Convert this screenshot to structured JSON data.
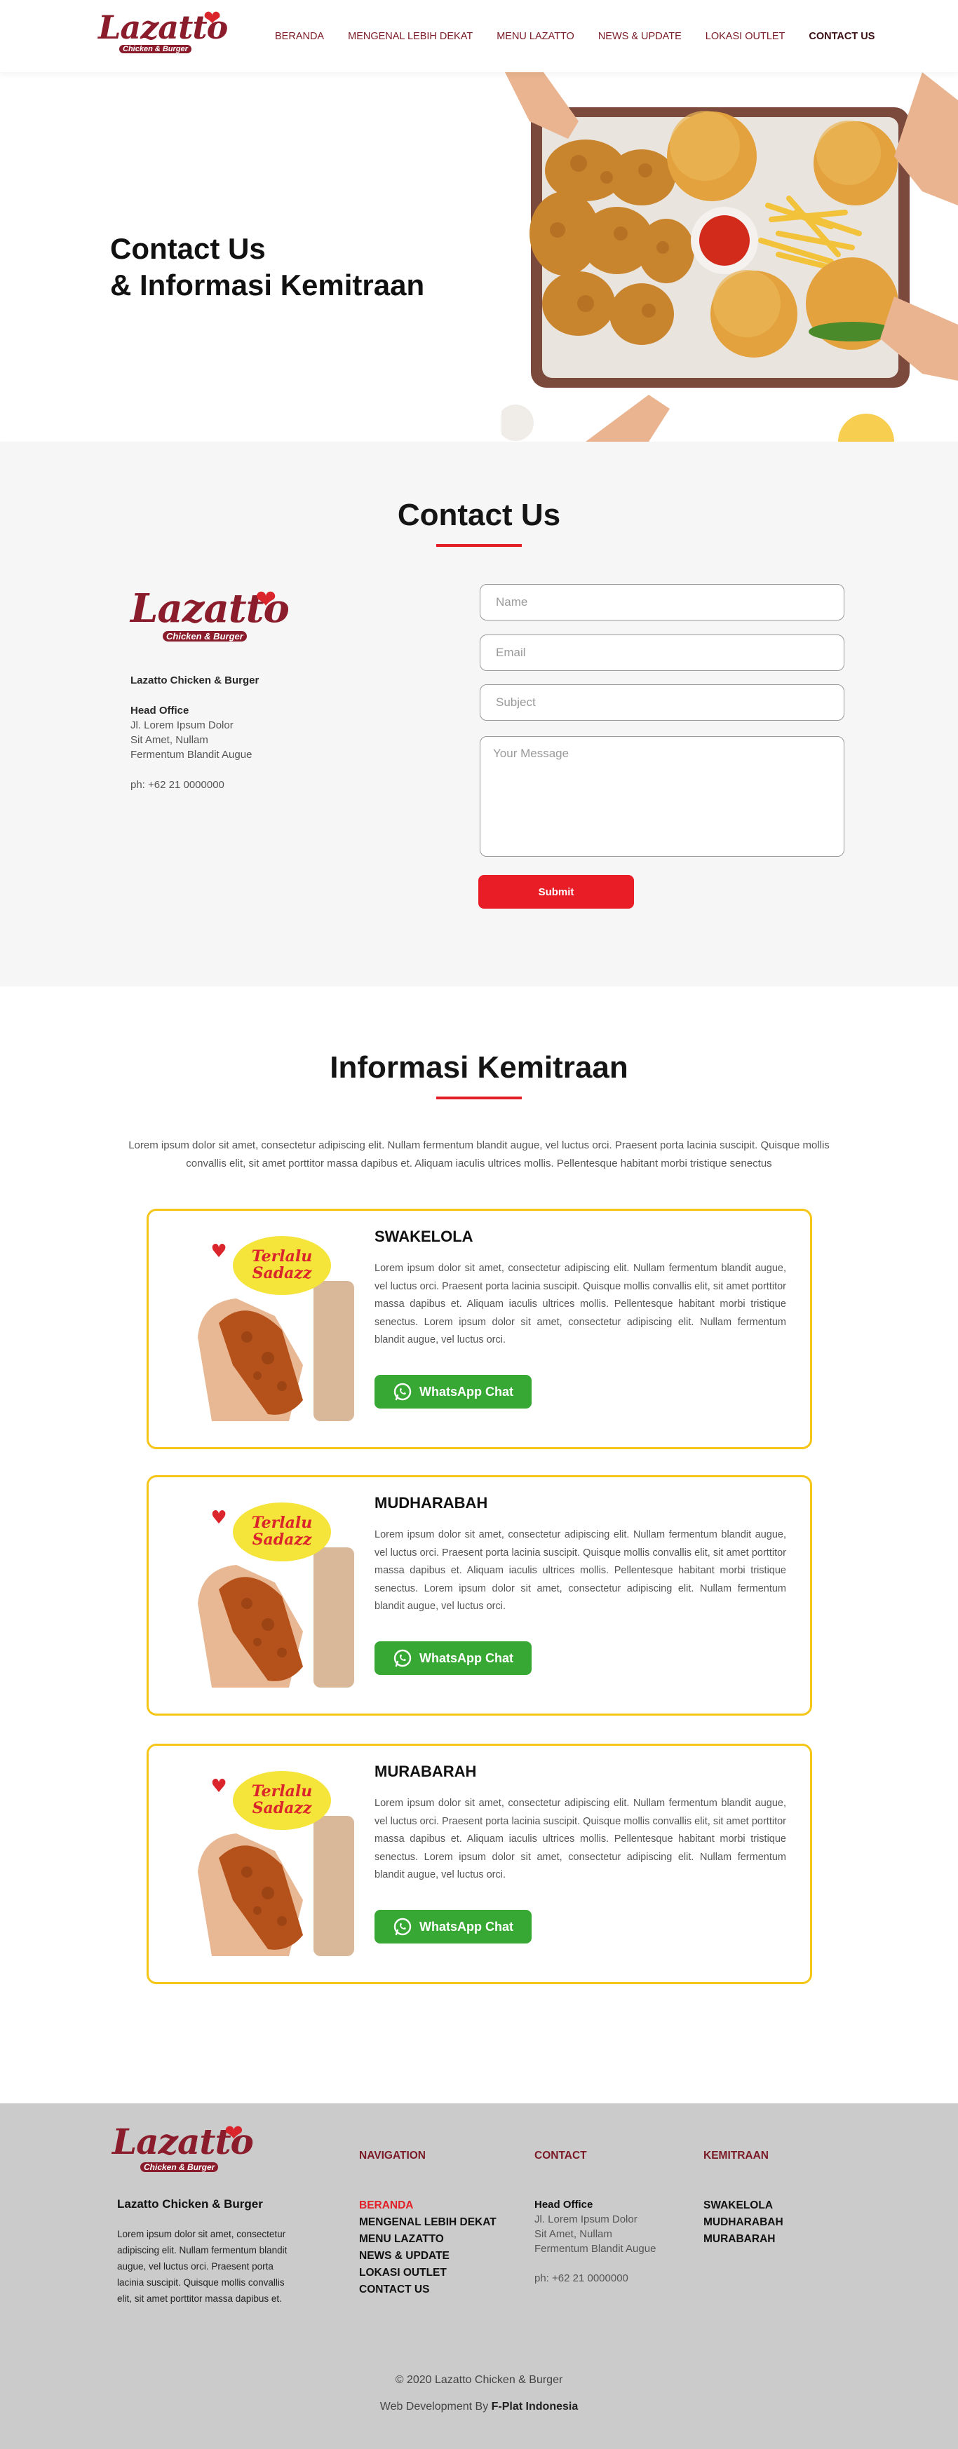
{
  "brand": {
    "logo_word": "Lazatto",
    "logo_sub": "Chicken & Burger",
    "name": "Lazatto Chicken & Burger"
  },
  "nav": {
    "items": [
      {
        "label": "BERANDA"
      },
      {
        "label": "MENGENAL LEBIH DEKAT"
      },
      {
        "label": "MENU LAZATTO"
      },
      {
        "label": "NEWS & UPDATE"
      },
      {
        "label": "LOKASI OUTLET"
      },
      {
        "label": "CONTACT US",
        "active": true
      }
    ]
  },
  "hero": {
    "line1": "Contact Us",
    "line2": "& Informasi Kemitraan"
  },
  "contact": {
    "title": "Contact Us",
    "company": "Lazatto Chicken & Burger",
    "office_label": "Head Office",
    "address_1": "Jl. Lorem Ipsum Dolor",
    "address_2": "Sit Amet, Nullam",
    "address_3": "Fermentum Blandit Augue",
    "phone": "ph: +62 21 0000000",
    "form": {
      "name_placeholder": "Name",
      "email_placeholder": "Email",
      "subject_placeholder": "Subject",
      "message_placeholder": "Your Message",
      "submit_label": "Submit"
    }
  },
  "kemitraan": {
    "title": "Informasi Kemitraan",
    "intro": "Lorem ipsum dolor sit amet, consectetur adipiscing elit. Nullam fermentum blandit augue, vel luctus orci. Praesent porta lacinia suscipit. Quisque mollis convallis elit, sit amet porttitor massa dapibus et. Aliquam iaculis ultrices mollis. Pellentesque habitant morbi tristique senectus",
    "promo_text_1": "Terlalu",
    "promo_text_2": "Sadazz",
    "cards": [
      {
        "title": "SWAKELOLA",
        "text": "Lorem ipsum dolor sit amet, consectetur adipiscing elit. Nullam fermentum blandit augue, vel luctus orci. Praesent porta lacinia suscipit. Quisque mollis convallis elit, sit amet porttitor massa dapibus et. Aliquam iaculis ultrices mollis. Pellentesque habitant morbi tristique senectus. Lorem ipsum dolor sit amet, consectetur adipiscing elit. Nullam fermentum blandit augue, vel luctus orci.",
        "button": "WhatsApp Chat"
      },
      {
        "title": "MUDHARABAH",
        "text": "Lorem ipsum dolor sit amet, consectetur adipiscing elit. Nullam fermentum blandit augue, vel luctus orci. Praesent porta lacinia suscipit. Quisque mollis convallis elit, sit amet porttitor massa dapibus et. Aliquam iaculis ultrices mollis. Pellentesque habitant morbi tristique senectus. Lorem ipsum dolor sit amet, consectetur adipiscing elit. Nullam fermentum blandit augue, vel luctus orci.",
        "button": "WhatsApp Chat"
      },
      {
        "title": "MURABARAH",
        "text": "Lorem ipsum dolor sit amet, consectetur adipiscing elit. Nullam fermentum blandit augue, vel luctus orci. Praesent porta lacinia suscipit. Quisque mollis convallis elit, sit amet porttitor massa dapibus et. Aliquam iaculis ultrices mollis. Pellentesque habitant morbi tristique senectus. Lorem ipsum dolor sit amet, consectetur adipiscing elit. Nullam fermentum blandit augue, vel luctus orci.",
        "button": "WhatsApp Chat"
      }
    ]
  },
  "footer": {
    "brand": "Lazatto Chicken & Burger",
    "about": "Lorem ipsum dolor sit amet, consectetur adipiscing elit. Nullam fermentum blandit augue, vel luctus orci. Praesent porta lacinia suscipit. Quisque mollis convallis elit, sit amet porttitor massa dapibus et.",
    "nav_heading": "NAVIGATION",
    "nav_links": [
      {
        "label": "BERANDA",
        "active": true
      },
      {
        "label": "MENGENAL LEBIH DEKAT"
      },
      {
        "label": "MENU LAZATTO"
      },
      {
        "label": "NEWS & UPDATE"
      },
      {
        "label": "LOKASI OUTLET"
      },
      {
        "label": "CONTACT US"
      }
    ],
    "contact_heading": "CONTACT",
    "office_label": "Head Office",
    "address_1": "Jl. Lorem Ipsum Dolor",
    "address_2": "Sit Amet, Nullam",
    "address_3": "Fermentum Blandit Augue",
    "phone": "ph: +62 21 0000000",
    "kemitraan_heading": "KEMITRAAN",
    "kemitraan_links": [
      "SWAKELOLA",
      "MUDHARABAH",
      "MURABARAH"
    ],
    "copyright": "2020 Lazatto Chicken & Burger",
    "credit_prefix": "Web Development By",
    "credit_name": "F-Plat Indonesia"
  },
  "colors": {
    "brand_maroon": "#8a1c2b",
    "accent_red": "#e21e26",
    "card_border": "#f5c518",
    "whatsapp_green": "#38a834",
    "footer_bg": "#cbcbcb"
  },
  "icons": {
    "heart": "heart-icon",
    "whatsapp": "whatsapp-icon",
    "copyright": "copyright-icon"
  }
}
